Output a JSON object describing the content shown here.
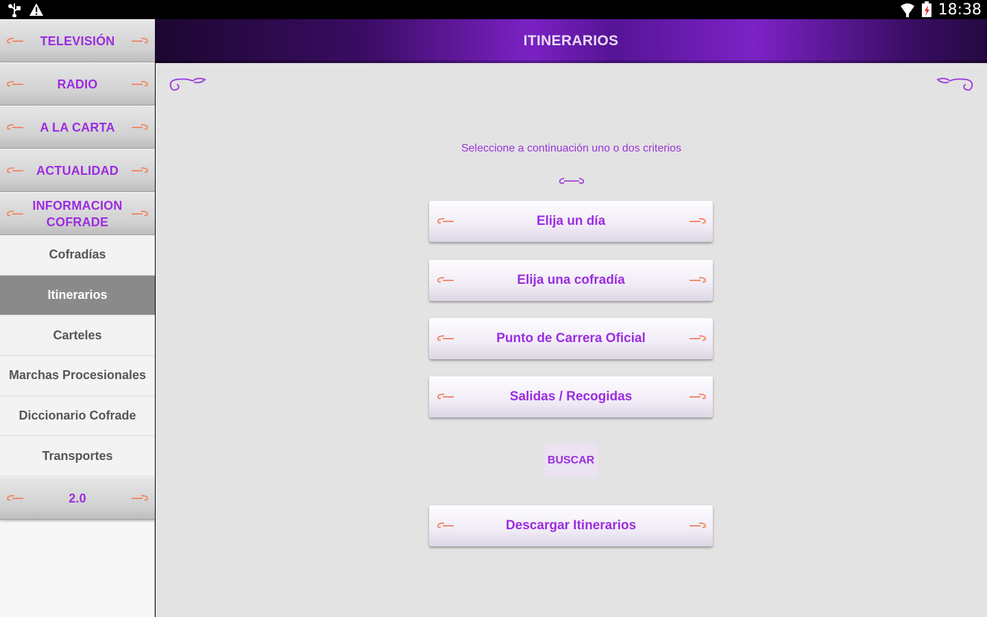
{
  "status_bar": {
    "time": "18:38",
    "left_icons": [
      "usb-icon",
      "warning-icon"
    ],
    "right_icons": [
      "wifi-icon",
      "battery-icon"
    ]
  },
  "header": {
    "title": "ITINERARIOS"
  },
  "sidebar": {
    "items": [
      {
        "label": "TELEVISIÓN",
        "type": "main"
      },
      {
        "label": "RADIO",
        "type": "main"
      },
      {
        "label": "A LA CARTA",
        "type": "main"
      },
      {
        "label": "ACTUALIDAD",
        "type": "main"
      },
      {
        "label": "INFORMACION COFRADE",
        "type": "main"
      },
      {
        "label": "Cofradías",
        "type": "sub"
      },
      {
        "label": "Itinerarios",
        "type": "sub",
        "active": true
      },
      {
        "label": "Carteles",
        "type": "sub"
      },
      {
        "label": "Marchas Procesionales",
        "type": "sub"
      },
      {
        "label": "Diccionario Cofrade",
        "type": "sub"
      },
      {
        "label": "Transportes",
        "type": "sub"
      },
      {
        "label": "2.0",
        "type": "main"
      }
    ]
  },
  "main": {
    "instruction": "Seleccione a continuación uno o dos criterios",
    "options": [
      {
        "label": "Elija un día"
      },
      {
        "label": "Elija una cofradía"
      },
      {
        "label": "Punto de Carrera Oficial"
      },
      {
        "label": "Salidas / Recogidas"
      }
    ],
    "search_label": "BUSCAR",
    "download_label": "Descargar Itinerarios"
  },
  "colors": {
    "accent": "#9b2ce0",
    "ornament": "#f08a6a",
    "header_purple": "#7b21c4"
  }
}
